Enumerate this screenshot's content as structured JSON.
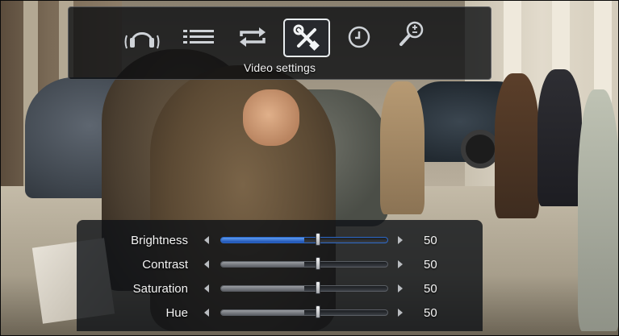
{
  "top_menu": {
    "items": [
      {
        "icon": "headphones-icon",
        "selected": false
      },
      {
        "icon": "list-icon",
        "selected": false
      },
      {
        "icon": "repeat-icon",
        "selected": false
      },
      {
        "icon": "tools-icon",
        "selected": true
      },
      {
        "icon": "clock-icon",
        "selected": false
      },
      {
        "icon": "zoom-icon",
        "selected": false
      }
    ],
    "selected_label": "Video settings"
  },
  "settings": [
    {
      "label": "Brightness",
      "value": "50",
      "level": 0.5,
      "active": true
    },
    {
      "label": "Contrast",
      "value": "50",
      "level": 0.5,
      "active": false
    },
    {
      "label": "Saturation",
      "value": "50",
      "level": 0.5,
      "active": false
    },
    {
      "label": "Hue",
      "value": "50",
      "level": 0.5,
      "active": false
    }
  ],
  "colors": {
    "accent": "#2f6fd6",
    "panel_bg": "#0e1116",
    "text": "#f4f4f4"
  }
}
